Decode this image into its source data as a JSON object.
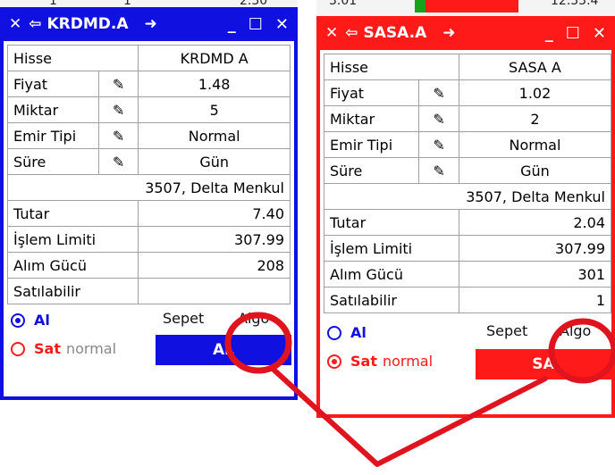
{
  "background_strip": {
    "left_values": [
      "1",
      "1",
      "2.30"
    ],
    "right_values": [
      "3.01",
      "12.33.4"
    ]
  },
  "windows": [
    {
      "title": "KRDMD.A",
      "rows": {
        "hisse": {
          "label": "Hisse",
          "value": "KRDMD A"
        },
        "fiyat": {
          "label": "Fiyat",
          "value": "1.48"
        },
        "miktar": {
          "label": "Miktar",
          "value": "5"
        },
        "emir_tipi": {
          "label": "Emir Tipi",
          "value": "Normal"
        },
        "sure": {
          "label": "Süre",
          "value": "Gün"
        },
        "broker": "3507, Delta Menkul",
        "tutar": {
          "label": "Tutar",
          "value": "7.40"
        },
        "islem_limiti": {
          "label": "İşlem Limiti",
          "value": "307.99"
        },
        "alim_gucu": {
          "label": "Alım Gücü",
          "value": "208"
        },
        "satilabilir": {
          "label": "Satılabilir",
          "value": ""
        }
      },
      "radio_al": "Al",
      "radio_sat": "Sat",
      "sat_mode": "normal",
      "sepet": "Sepet",
      "algo": "Algo",
      "action_button": "AL"
    },
    {
      "title": "SASA.A",
      "rows": {
        "hisse": {
          "label": "Hisse",
          "value": "SASA A"
        },
        "fiyat": {
          "label": "Fiyat",
          "value": "1.02"
        },
        "miktar": {
          "label": "Miktar",
          "value": "2"
        },
        "emir_tipi": {
          "label": "Emir Tipi",
          "value": "Normal"
        },
        "sure": {
          "label": "Süre",
          "value": "Gün"
        },
        "broker": "3507, Delta Menkul",
        "tutar": {
          "label": "Tutar",
          "value": "2.04"
        },
        "islem_limiti": {
          "label": "İşlem Limiti",
          "value": "307.99"
        },
        "alim_gucu": {
          "label": "Alım Gücü",
          "value": "301"
        },
        "satilabilir": {
          "label": "Satılabilir",
          "value": "1"
        }
      },
      "radio_al": "Al",
      "radio_sat": "Sat",
      "sat_mode": "normal",
      "sepet": "Sepet",
      "algo": "Algo",
      "action_button": "SA"
    }
  ],
  "titlebar_icons": [
    "close-icon",
    "back-arrow-icon",
    "forward-arrow-icon",
    "minimize-icon",
    "maximize-icon",
    "close-icon"
  ],
  "annotation_color": "#e0141e"
}
